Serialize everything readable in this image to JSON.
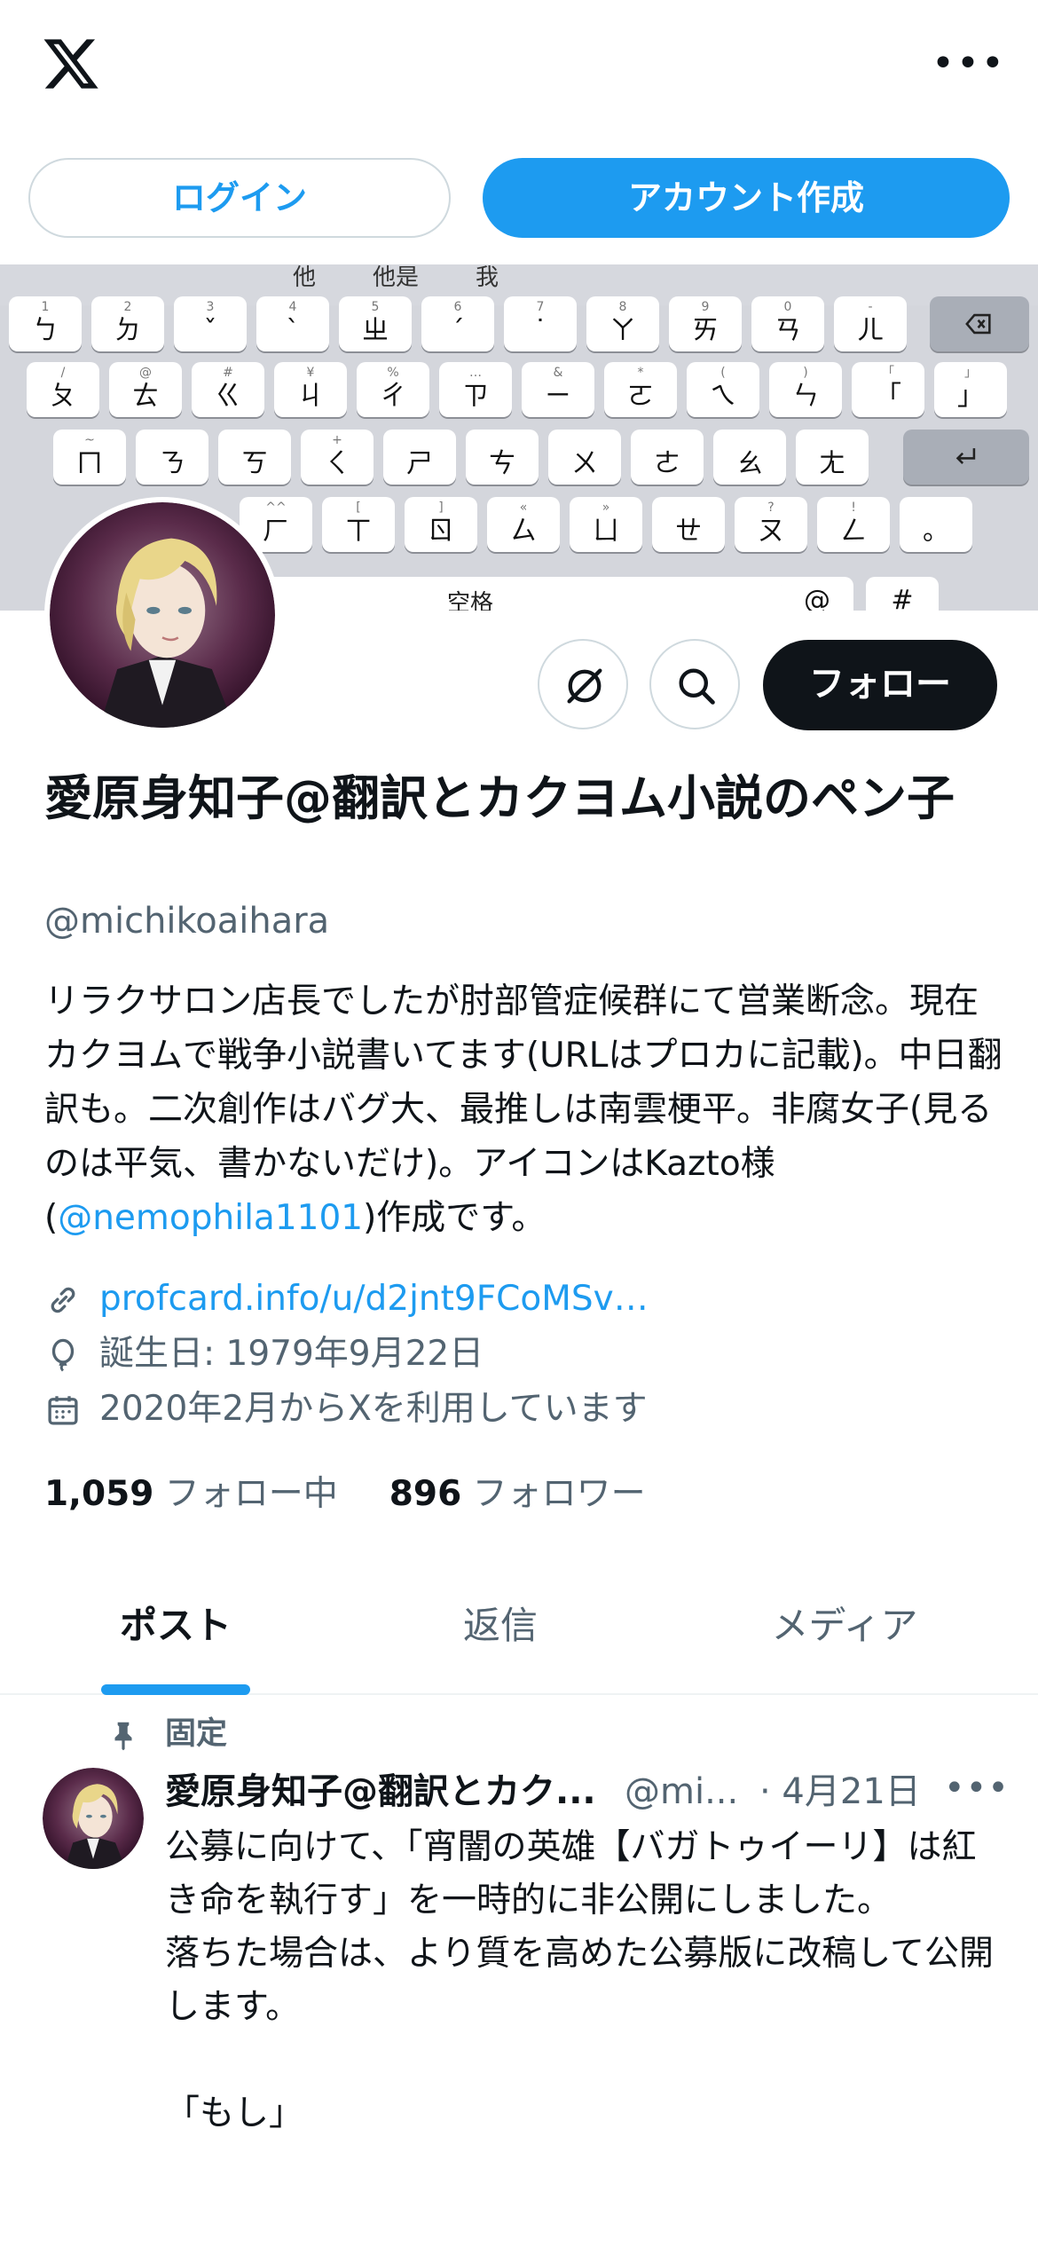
{
  "header": {
    "logo_icon": "x-logo-icon",
    "more_icon": "more-horizontal-icon",
    "more_glyph": "•••",
    "login_label": "ログイン",
    "signup_label": "アカウント作成",
    "accent_color": "#1d9bf0"
  },
  "banner": {
    "suggestions": [
      "他",
      "他是",
      "我"
    ],
    "keys_row1": [
      [
        "1",
        "ㄅ"
      ],
      [
        "2",
        "ㄉ"
      ],
      [
        "3",
        "ˇ"
      ],
      [
        "4",
        "ˋ"
      ],
      [
        "5",
        "ㄓ"
      ],
      [
        "6",
        "ˊ"
      ],
      [
        "7",
        "˙"
      ],
      [
        "8",
        "ㄚ"
      ],
      [
        "9",
        "ㄞ"
      ],
      [
        "0",
        "ㄢ"
      ],
      [
        "-",
        "ㄦ"
      ]
    ],
    "keys_row2": [
      [
        "/",
        "ㄆ"
      ],
      [
        "@",
        "ㄊ"
      ],
      [
        "#",
        "ㄍ"
      ],
      [
        "¥",
        "ㄐ"
      ],
      [
        "%",
        "ㄔ"
      ],
      [
        "…",
        "ㄗ"
      ],
      [
        "&",
        "ㄧ"
      ],
      [
        "*",
        "ㄛ"
      ],
      [
        "(",
        "ㄟ"
      ],
      [
        ")",
        "ㄣ"
      ],
      [
        "「",
        "「"
      ],
      [
        "」",
        "」"
      ]
    ],
    "keys_row3": [
      [
        "~",
        "ㄇ"
      ],
      [
        "",
        "ㄋ"
      ],
      [
        "",
        "ㄎ"
      ],
      [
        "+",
        "ㄑ"
      ],
      [
        "",
        "ㄕ"
      ],
      [
        "",
        "ㄘ"
      ],
      [
        "",
        "ㄨ"
      ],
      [
        "",
        "ㄜ"
      ],
      [
        "",
        "ㄠ"
      ],
      [
        "",
        "ㄤ"
      ]
    ],
    "keys_row4": [
      [
        "^^",
        "ㄏ"
      ],
      [
        "[",
        "ㄒ"
      ],
      [
        "]",
        "ㄖ"
      ],
      [
        "«",
        "ㄙ"
      ],
      [
        "»",
        "ㄩ"
      ],
      [
        "",
        "ㄝ"
      ],
      [
        "?",
        "ㄡ"
      ],
      [
        "!",
        "ㄥ"
      ],
      [
        "",
        "。"
      ]
    ],
    "space_label": "空格",
    "bottom_keys": [
      "@",
      "#"
    ]
  },
  "actions": {
    "grok_icon": "grok-icon",
    "search_icon": "search-icon",
    "follow_label": "フォロー"
  },
  "profile": {
    "name": "愛原身知子@翻訳とカクヨム小説のペン子",
    "handle": "@michikoaihara",
    "bio_main": "リラクサロン店長でしたが肘部管症候群にて営業断念。現在カクヨムで戦争小説書いてます(URLはプロカに記載)。中日翻訳も。二次創作はバグ大、最推しは南雲梗平。非腐女子(見るのは平気、書かないだけ)。アイコンはKazto様(",
    "bio_mention": "@nemophila1101",
    "bio_tail": ")作成です。",
    "link": "profcard.info/u/d2jnt9FCoMSv…",
    "birthday": "誕生日: 1979年9月22日",
    "joined": "2020年2月からXを利用しています",
    "following_count": "1,059",
    "following_label": "フォロー中",
    "followers_count": "896",
    "followers_label": "フォロワー"
  },
  "tabs": [
    "ポスト",
    "返信",
    "メディア"
  ],
  "post": {
    "pinned_label": "固定",
    "author_name": "愛原身知子@翻訳とカク...",
    "author_handle": "@mi...",
    "date": "· 4月21日",
    "more_glyph": "•••",
    "body": "公募に向けて、「宵闇の英雄【バガトゥイーリ】は紅き命を執行す」を一時的に非公開にしました。\n落ちた場合は、より質を高めた公募版に改稿して公開します。\n\n「もし」"
  }
}
